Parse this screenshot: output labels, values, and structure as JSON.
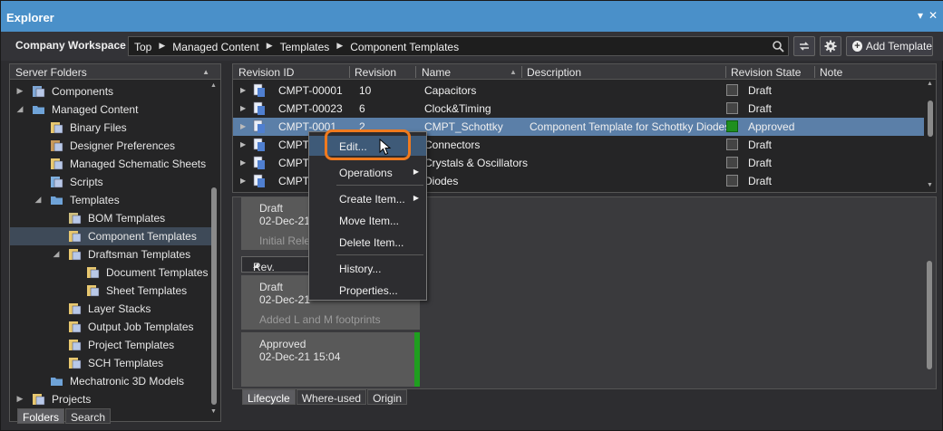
{
  "window": {
    "title": "Explorer",
    "controls": [
      "▾",
      "✕"
    ]
  },
  "toolbar": {
    "workspace": "Company Workspace",
    "breadcrumbs": [
      "Top",
      "Managed Content",
      "Templates",
      "Component Templates"
    ],
    "add_template_label": "Add Template"
  },
  "left_panel": {
    "header": "Server Folders",
    "tree": [
      {
        "label": "Components",
        "expander": "▶",
        "icon": "components-icon"
      },
      {
        "label": "Managed Content",
        "expander": "◢",
        "icon": "folder-icon"
      },
      {
        "label": "Binary Files",
        "expander": "",
        "icon": "binary-files-icon"
      },
      {
        "label": "Designer Preferences",
        "expander": "",
        "icon": "preferences-icon"
      },
      {
        "label": "Managed Schematic Sheets",
        "expander": "",
        "icon": "schematic-sheets-icon"
      },
      {
        "label": "Scripts",
        "expander": "",
        "icon": "scripts-icon"
      },
      {
        "label": "Templates",
        "expander": "◢",
        "icon": "folder-icon"
      },
      {
        "label": "BOM Templates",
        "expander": "",
        "icon": "bom-templates-icon"
      },
      {
        "label": "Component Templates",
        "expander": "",
        "icon": "component-templates-icon",
        "selected": true
      },
      {
        "label": "Draftsman Templates",
        "expander": "◢",
        "icon": "draftsman-templates-icon"
      },
      {
        "label": "Document Templates",
        "expander": "",
        "icon": "document-templates-icon"
      },
      {
        "label": "Sheet Templates",
        "expander": "",
        "icon": "sheet-templates-icon"
      },
      {
        "label": "Layer Stacks",
        "expander": "",
        "icon": "layer-stacks-icon"
      },
      {
        "label": "Output Job Templates",
        "expander": "",
        "icon": "output-job-icon"
      },
      {
        "label": "Project Templates",
        "expander": "",
        "icon": "project-templates-icon"
      },
      {
        "label": "SCH Templates",
        "expander": "",
        "icon": "sch-templates-icon"
      },
      {
        "label": "Mechatronic 3D Models",
        "expander": "",
        "icon": "folder-icon"
      },
      {
        "label": "Projects",
        "expander": "▶",
        "icon": "projects-icon"
      }
    ],
    "tabs": [
      "Folders",
      "Search"
    ]
  },
  "grid": {
    "columns": [
      "Revision ID",
      "Revision",
      "Name",
      "Description",
      "Revision State",
      "Note"
    ],
    "rows": [
      {
        "id": "CMPT-00001",
        "rev": "10",
        "name": "Capacitors",
        "desc": "",
        "state": "Draft"
      },
      {
        "id": "CMPT-00023",
        "rev": "6",
        "name": "Clock&Timing",
        "desc": "",
        "state": "Draft"
      },
      {
        "id": "CMPT-0001",
        "rev": "2",
        "name": "CMPT_Schottky",
        "desc": "Component Template for Schottky Diodes",
        "state": "Approved",
        "selected": true
      },
      {
        "id": "CMPT-",
        "rev": "",
        "name": "Connectors",
        "desc": "",
        "state": "Draft"
      },
      {
        "id": "CMPT-",
        "rev": "",
        "name": "Crystals & Oscillators",
        "desc": "",
        "state": "Draft"
      },
      {
        "id": "CMPT-",
        "rev": "",
        "name": "Diodes",
        "desc": "",
        "state": "Draft"
      }
    ]
  },
  "lifecycle": {
    "card1_state": "Draft",
    "card1_date": "02-Dec-21",
    "card1_note": "Initial Rele",
    "rev_header": "Rev. 2",
    "card2_state": "Draft",
    "card2_date": "02-Dec-21",
    "card2_note": "Added L and M footprints",
    "card3_state": "Approved",
    "card3_date": "02-Dec-21 15:04",
    "tabs": [
      "Lifecycle",
      "Where-used",
      "Origin"
    ]
  },
  "context_menu": {
    "items": [
      "Edit...",
      "Operations",
      "Create Item...",
      "Move Item...",
      "Delete Item...",
      "History...",
      "Properties..."
    ]
  },
  "colors": {
    "title_bar": "#4a90c9",
    "selection": "#5b7fa8",
    "approved": "#1f8f1f",
    "highlight_ring": "#f07a1e"
  }
}
